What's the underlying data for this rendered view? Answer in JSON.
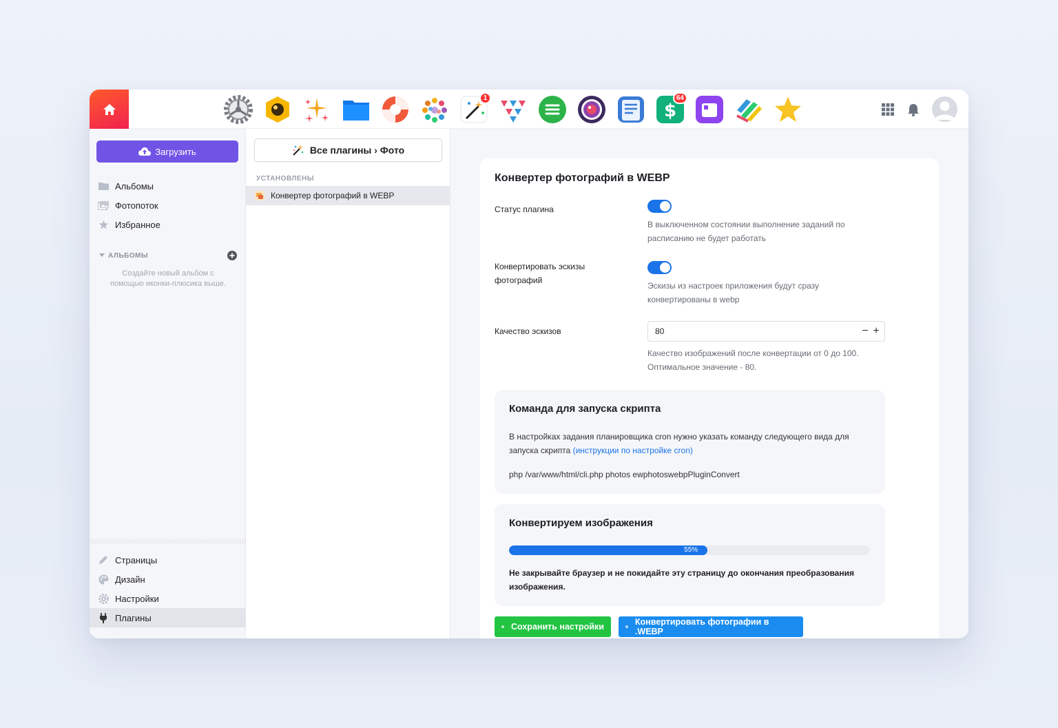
{
  "topbar": {
    "apps": [
      {
        "name": "settings",
        "icon": "gear-icon",
        "badge": ""
      },
      {
        "name": "installer",
        "icon": "hexagon-icon",
        "badge": ""
      },
      {
        "name": "sparkles",
        "icon": "sparkles-icon",
        "badge": ""
      },
      {
        "name": "files",
        "icon": "folder-icon",
        "badge": ""
      },
      {
        "name": "support",
        "icon": "lifebuoy-icon",
        "badge": ""
      },
      {
        "name": "mosaic",
        "icon": "mosaic-icon",
        "badge": ""
      },
      {
        "name": "magic",
        "icon": "magic-wand-icon",
        "badge": "1"
      },
      {
        "name": "mailer",
        "icon": "paper-planes-icon",
        "badge": ""
      },
      {
        "name": "tasks",
        "icon": "list-icon",
        "badge": ""
      },
      {
        "name": "photos",
        "icon": "camera-lens-icon",
        "badge": ""
      },
      {
        "name": "checklists",
        "icon": "checklist-icon",
        "badge": ""
      },
      {
        "name": "shop",
        "icon": "dollar-icon",
        "badge": "64"
      },
      {
        "name": "hub",
        "icon": "blocks-icon",
        "badge": ""
      },
      {
        "name": "kanban",
        "icon": "ribbons-icon",
        "badge": ""
      },
      {
        "name": "favorites",
        "icon": "star-icon",
        "badge": ""
      }
    ]
  },
  "sidebar": {
    "upload_label": "Загрузить",
    "items": [
      {
        "label": "Альбомы",
        "icon": "folder-icon"
      },
      {
        "label": "Фотопоток",
        "icon": "photostream-icon"
      },
      {
        "label": "Избранное",
        "icon": "star-icon"
      }
    ],
    "albums_title": "АЛЬБОМЫ",
    "albums_hint": "Создайте новый альбом с помощью иконки-плюсика выше.",
    "bottom_items": [
      {
        "label": "Страницы",
        "icon": "pencil-icon"
      },
      {
        "label": "Дизайн",
        "icon": "palette-icon"
      },
      {
        "label": "Настройки",
        "icon": "gear-icon"
      },
      {
        "label": "Плагины",
        "icon": "plug-icon"
      }
    ]
  },
  "middle": {
    "all_plugins_label": "Все плагины › Фото",
    "installed_label": "УСТАНОВЛЕНЫ",
    "plugin_name": "Конвертер фотографий в WEBP"
  },
  "panel": {
    "title": "Конвертер фотографий в WEBP",
    "status_label": "Статус плагина",
    "status_desc": "В выключенном состоянии выполнение заданий по расписанию не будет работать",
    "thumbs_label": "Конвертировать эскизы фотографий",
    "thumbs_desc": "Эскизы из настроек приложения будут сразу конвертированы в webp",
    "quality_label": "Качество эскизов",
    "quality_value": "80",
    "quality_minus": "−",
    "quality_plus": "+",
    "quality_desc": "Качество изображений после конвертации от 0 до 100. Оптимальное значение - 80.",
    "cron_title": "Команда для запуска скрипта",
    "cron_text": "В настройках задания планировщика cron нужно указать команду следующего вида для запуска скрипта",
    "cron_link": "(инструкции по настройке cron)",
    "cron_command": "php /var/www/html/cli.php photos ewphotoswebpPluginConvert",
    "convert_title": "Конвертируем изображения",
    "progress": 55,
    "progress_text": "55%",
    "warning": "Не закрывайте браузер и не покидайте эту страницу до окончания преобразования изображения.",
    "save_label": "Сохранить настройки",
    "convert_label": "Конвертировать фотографии в .WEBP"
  },
  "colors": {
    "accent": "#1a73e8",
    "upload": "#7154e6",
    "save": "#22c442",
    "convert": "#1a8cf0"
  }
}
